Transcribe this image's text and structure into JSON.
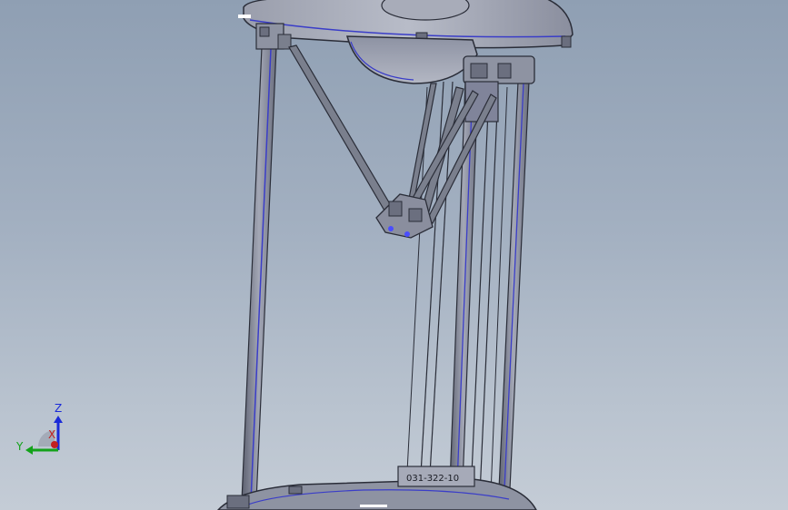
{
  "viewport": {
    "background_top": "#8f9fb3",
    "background_bottom": "#c4ccd6"
  },
  "model": {
    "name": "delta-3d-printer-assembly",
    "part_label": "031-322-10"
  },
  "triad": {
    "z_label": "Z",
    "y_label": "Y",
    "x_label": "X",
    "z_color": "#1a2ad8",
    "y_color": "#13a21a",
    "x_color": "#c22020"
  },
  "colors": {
    "edge": "#2a2d38",
    "body": "#7a7f8d",
    "highlight": "#4a4dff"
  }
}
